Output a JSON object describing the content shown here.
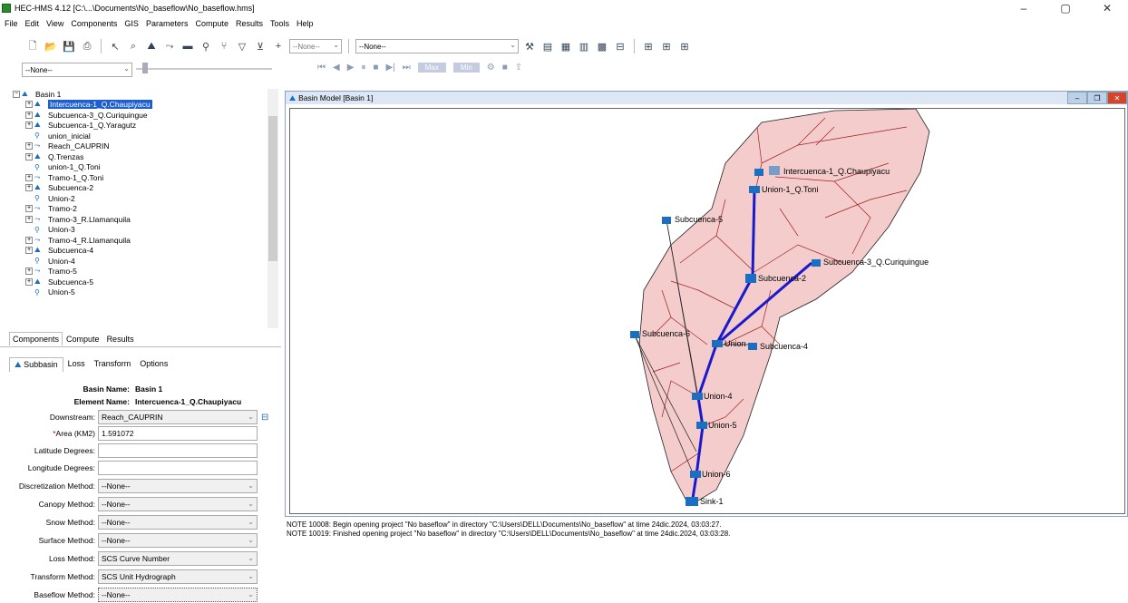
{
  "window": {
    "title": "HEC-HMS 4.12 [C:\\...\\Documents\\No_baseflow\\No_baseflow.hms]"
  },
  "menu": [
    "File",
    "Edit",
    "View",
    "Components",
    "GIS",
    "Parameters",
    "Compute",
    "Results",
    "Tools",
    "Help"
  ],
  "toolbar": {
    "none_small": "--None--",
    "none_select": "--None--",
    "none_left": "--None--",
    "max_label": "Max",
    "min_label": "Min"
  },
  "tree": {
    "items": [
      {
        "label": "Basin 1",
        "type": "basin",
        "level": 0,
        "expander": "−"
      },
      {
        "label": "Intercuenca-1_Q.Chaupiyacu",
        "type": "subbasin",
        "level": 1,
        "expander": "+",
        "selected": true
      },
      {
        "label": "Subcuenca-3_Q.Curiquingue",
        "type": "subbasin",
        "level": 1,
        "expander": "+"
      },
      {
        "label": "Subcuenca-1_Q.Yaragutz",
        "type": "subbasin",
        "level": 1,
        "expander": "+"
      },
      {
        "label": "union_inicial",
        "type": "junction",
        "level": 1,
        "expander": ""
      },
      {
        "label": "Reach_CAUPRIN",
        "type": "reach",
        "level": 1,
        "expander": "+"
      },
      {
        "label": "Q.Trenzas",
        "type": "subbasin",
        "level": 1,
        "expander": "+"
      },
      {
        "label": "union-1_Q.Toni",
        "type": "junction",
        "level": 1,
        "expander": ""
      },
      {
        "label": "Tramo-1_Q.Toni",
        "type": "reach",
        "level": 1,
        "expander": "+"
      },
      {
        "label": "Subcuenca-2",
        "type": "subbasin",
        "level": 1,
        "expander": "+"
      },
      {
        "label": "Union-2",
        "type": "junction",
        "level": 1,
        "expander": ""
      },
      {
        "label": "Tramo-2",
        "type": "reach",
        "level": 1,
        "expander": "+"
      },
      {
        "label": "Tramo-3_R.Llamanquila",
        "type": "reach",
        "level": 1,
        "expander": "+"
      },
      {
        "label": "Union-3",
        "type": "junction",
        "level": 1,
        "expander": ""
      },
      {
        "label": "Tramo-4_R.Llamanquila",
        "type": "reach",
        "level": 1,
        "expander": "+"
      },
      {
        "label": "Subcuenca-4",
        "type": "subbasin",
        "level": 1,
        "expander": "+"
      },
      {
        "label": "Union-4",
        "type": "junction",
        "level": 1,
        "expander": ""
      },
      {
        "label": "Tramo-5",
        "type": "reach",
        "level": 1,
        "expander": "+"
      },
      {
        "label": "Subcuenca-5",
        "type": "subbasin",
        "level": 1,
        "expander": "+"
      },
      {
        "label": "Union-5",
        "type": "junction",
        "level": 1,
        "expander": ""
      }
    ]
  },
  "panel_tabs": [
    "Components",
    "Compute",
    "Results"
  ],
  "sub_tabs": [
    "Subbasin",
    "Loss",
    "Transform",
    "Options"
  ],
  "form": {
    "basin_name_label": "Basin Name:",
    "basin_name": "Basin 1",
    "element_name_label": "Element Name:",
    "element_name": "Intercuenca-1_Q.Chaupiyacu",
    "downstream_label": "Downstream:",
    "downstream": "Reach_CAUPRIN",
    "area_label": "Area (KM2)",
    "area_required": "*",
    "area": "1.591072",
    "latitude_label": "Latitude Degrees:",
    "latitude": "",
    "longitude_label": "Longitude Degrees:",
    "longitude": "",
    "discretization_label": "Discretization Method:",
    "discretization": "--None--",
    "canopy_label": "Canopy Method:",
    "canopy": "--None--",
    "snow_label": "Snow Method:",
    "snow": "--None--",
    "surface_label": "Surface Method:",
    "surface": "--None--",
    "loss_label": "Loss Method:",
    "loss": "SCS Curve Number",
    "transform_label": "Transform Method:",
    "transform": "SCS Unit Hydrograph",
    "baseflow_label": "Baseflow Method:",
    "baseflow": "--None--"
  },
  "basin_window": {
    "title": "Basin Model [Basin 1]"
  },
  "map_labels": {
    "intercuenca": "Intercuenca-1_Q.Chaupiyacu",
    "union1": "Union-1_Q.Toni",
    "sub5": "Subcuenca-5",
    "sub3": "Subcuenca-3_Q.Curiquingue",
    "sub2": "Subcuenca-2",
    "sub6": "Subcuenca-6",
    "union": "Union",
    "sub4": "Subcuenca-4",
    "union4": "Union-4",
    "union5": "Union-5",
    "union6": "Union-6",
    "sink": "Sink-1"
  },
  "log": [
    "NOTE 10008:  Begin opening project \"No baseflow\" in directory \"C:\\Users\\DELL\\Documents\\No_baseflow\" at time 24dic.2024, 03:03:27.",
    "NOTE 10019:  Finished opening project \"No baseflow\" in directory \"C:\\Users\\DELL\\Documents\\No_baseflow\" at time 24dic.2024, 03:03:28."
  ],
  "colors": {
    "selection": "#1e5fd0",
    "basin_fill": "#f4cccc",
    "river": "#a02020",
    "reach": "#1a1acc"
  }
}
